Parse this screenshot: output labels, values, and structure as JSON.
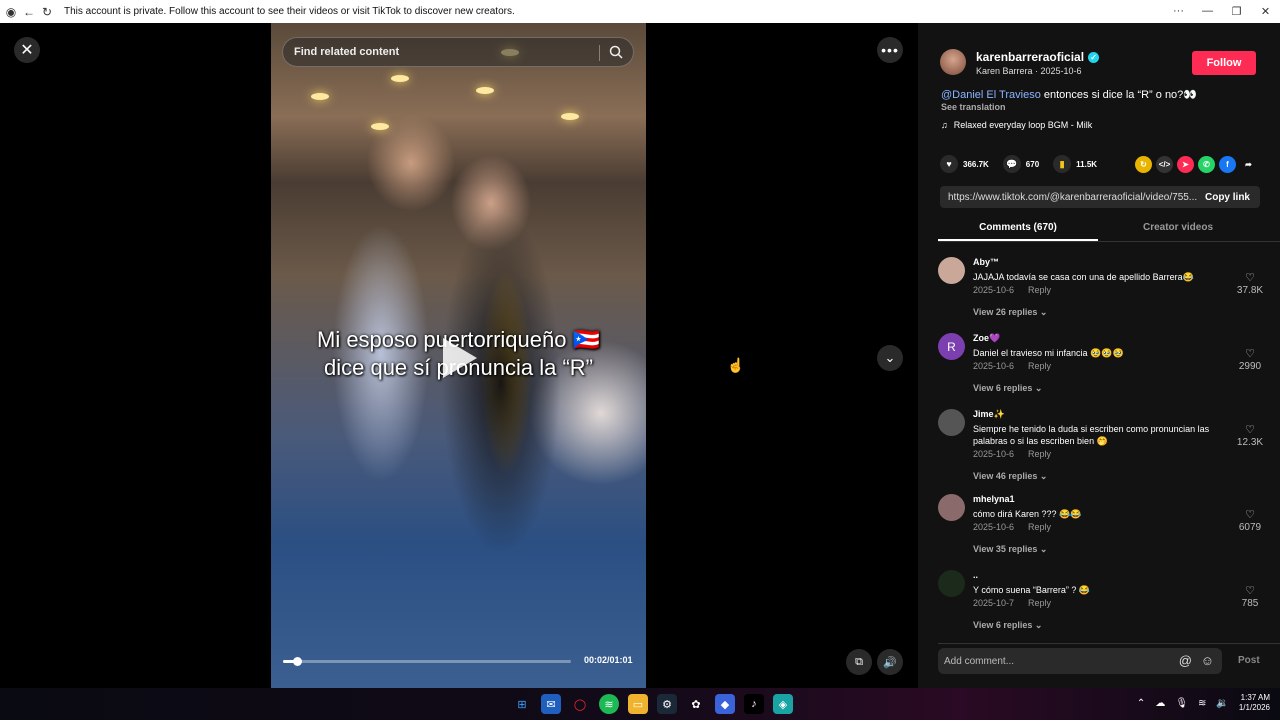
{
  "window": {
    "banner_text": "This account is private. Follow this account to see their videos or visit TikTok to discover new creators.",
    "controls": [
      "···",
      "—",
      "❐",
      "✕"
    ]
  },
  "video": {
    "search_placeholder": "Find related content",
    "caption_line1": "Mi esposo puertorriqueño 🇵🇷",
    "caption_line2": "dice que sí pronuncia la “R”",
    "time": "00:02/01:01",
    "progress": 0.05
  },
  "post": {
    "username": "karenbarreraoficial",
    "display_line": "Karen Barrera · 2025-10-6",
    "follow_label": "Follow",
    "mention": "@Daniel El Travieso",
    "description": " entonces si dice la “R” o no?👀",
    "see_translation": "See translation",
    "music": "Relaxed everyday loop BGM - Milk",
    "likes": "366.7K",
    "comments_count": "670",
    "saves": "11.5K",
    "link": "https://www.tiktok.com/@karenbarreraoficial/video/755...",
    "copy_link": "Copy link"
  },
  "tabs": [
    {
      "label": "Comments (670)",
      "active": true
    },
    {
      "label": "Creator videos",
      "active": false
    }
  ],
  "comments": [
    {
      "name": "Aby™",
      "text": "JAJAJA todavía se casa con una de apellido Barrera😂",
      "date": "2025-10-6",
      "reply": "Reply",
      "views": "View 26 replies ⌄",
      "likes": "37.8K",
      "avatar_color": "#c9a89a"
    },
    {
      "name": "Zoe💜",
      "text": "Daniel el travieso mi infancia 🥹🥹🥹",
      "date": "2025-10-6",
      "reply": "Reply",
      "views": "View 6 replies ⌄",
      "likes": "2990",
      "avatar_color": "#7b3fb0",
      "avatar_letter": "R"
    },
    {
      "name": "Jime✨",
      "text": "Siempre he tenido la duda si escriben como pronuncian las palabras o si las escriben bien 🤭",
      "date": "2025-10-6",
      "reply": "Reply",
      "views": "View 46 replies ⌄",
      "likes": "12.3K",
      "avatar_color": "#555"
    },
    {
      "name": "mhelyna1",
      "text": "cómo dirá Karen ??? 😂😂",
      "date": "2025-10-6",
      "reply": "Reply",
      "views": "View 35 replies ⌄",
      "likes": "6079",
      "avatar_color": "#8a6a6a"
    },
    {
      "name": "..",
      "text": "Y cómo suena “Barrera” ? 😂",
      "date": "2025-10-7",
      "reply": "Reply",
      "views": "View 6 replies ⌄",
      "likes": "785",
      "avatar_color": "#1b2a1b"
    }
  ],
  "add_comment": {
    "placeholder": "Add comment...",
    "post_label": "Post"
  },
  "taskbar": {
    "time": "1:37 AM",
    "date": "1/1/2026"
  }
}
